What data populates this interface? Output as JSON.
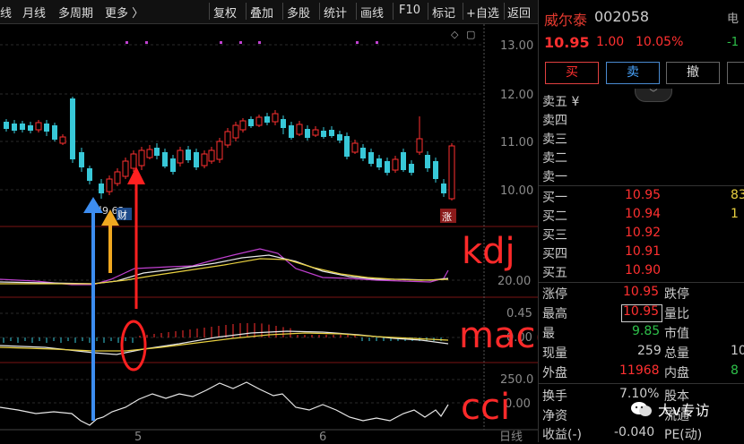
{
  "toolbar": {
    "items": [
      "线",
      "月线",
      "多周期",
      "更多 〉",
      "复权",
      "叠加",
      "多股",
      "统计",
      "画线",
      "F10",
      "标记",
      "+自选",
      "返回"
    ]
  },
  "chart": {
    "price_ticks": [
      "13.00",
      "12.00",
      "11.00",
      "10.00"
    ],
    "kdj_ticks": [
      "20.00"
    ],
    "macd_ticks": [
      "0.45",
      "0.00"
    ],
    "cci_ticks": [
      "250.0",
      "0.00"
    ],
    "x_ticks": [
      "5",
      "6"
    ],
    "x_axis_label": "日线",
    "low_marker": "9.63",
    "finance_badge": "财",
    "limit_badge": "涨"
  },
  "annotations": {
    "kdj": "kdj",
    "macd": "macd",
    "cci": "cci"
  },
  "watermark": {
    "text": "大v专访"
  },
  "quote": {
    "name": "威尔泰",
    "code": "002058",
    "price": "10.95",
    "change": "1.00",
    "change_pct": "10.05%",
    "right_cut_1": "电",
    "right_cut_2": "-1"
  },
  "buttons": {
    "buy": "买",
    "sell": "卖",
    "cancel": "撤"
  },
  "sell_levels": [
    "卖五 ¥",
    "卖四",
    "卖三",
    "卖二",
    "卖一"
  ],
  "buy_levels": [
    {
      "label": "买一",
      "price": "10.95",
      "cut": "83"
    },
    {
      "label": "买二",
      "price": "10.94",
      "cut": "1"
    },
    {
      "label": "买三",
      "price": "10.92",
      "cut": ""
    },
    {
      "label": "买四",
      "price": "10.91",
      "cut": ""
    },
    {
      "label": "买五",
      "price": "10.90",
      "cut": ""
    }
  ],
  "stats": {
    "limit_up_label": "涨停",
    "limit_up": "10.95",
    "limit_down_label": "跌停",
    "high_label": "最高",
    "high": "10.95",
    "vol_ratio_label": "量比",
    "low_label": "最",
    "low": "9.85",
    "mkt_cap_label": "市值",
    "now_vol_label": "现量",
    "now_vol": "259",
    "total_vol_label": "总量",
    "total_vol_cut": "10",
    "outer_label": "外盘",
    "outer": "11968",
    "inner_label": "内盘",
    "inner_cut": "8",
    "turnover_label": "换手",
    "turnover": "7.10%",
    "equity_label": "股本",
    "net_asset_label": "净资",
    "float_label": "流通",
    "eps_label": "收益(-)",
    "eps": "-0.040",
    "pe_label": "PE(动)"
  }
}
